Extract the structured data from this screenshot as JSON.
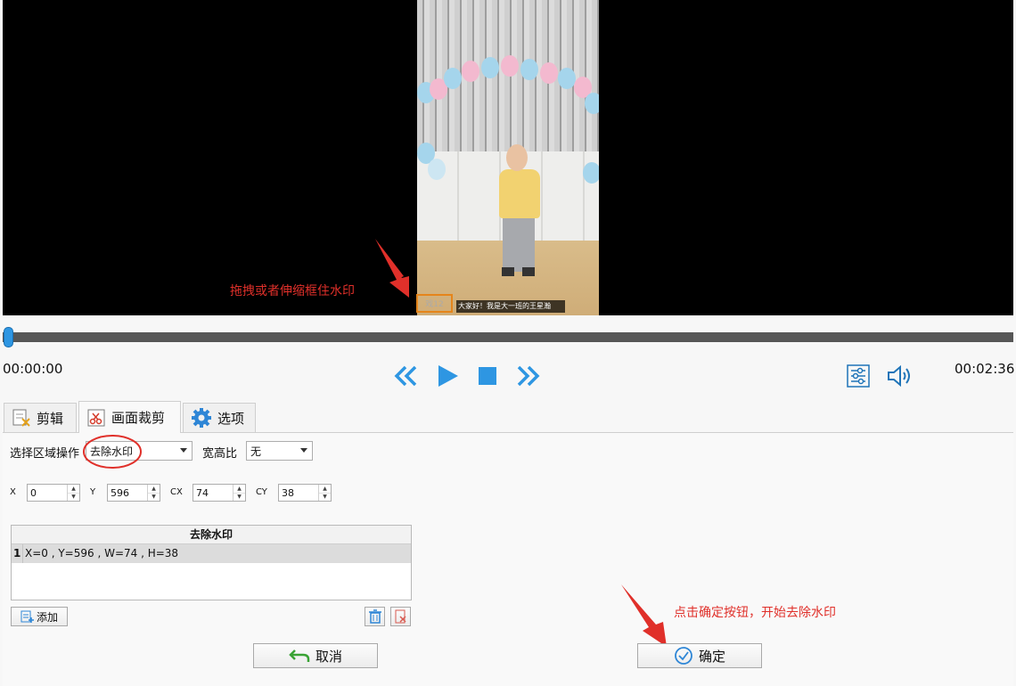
{
  "video": {
    "watermark_text": "戏12",
    "subtitle": "大家好！我是大一班的王星瀚"
  },
  "annotations": {
    "drag_hint": "拖拽或者伸缩框住水印",
    "confirm_hint": "点击确定按钮，开始去除水印",
    "color": "#e0302a"
  },
  "timeline": {
    "current_time": "00:00:00",
    "total_time": "00:02:36",
    "progress": 0
  },
  "tabs": [
    {
      "label": "剪辑",
      "icon": "scissors-doc-icon"
    },
    {
      "label": "画面裁剪",
      "icon": "crop-icon",
      "active": true
    },
    {
      "label": "选项",
      "icon": "gear-icon"
    }
  ],
  "panel": {
    "select_region_label": "选择区域操作",
    "region_op_value": "去除水印",
    "aspect_label": "宽高比",
    "aspect_value": "无",
    "x_label": "X",
    "x_value": "0",
    "y_label": "Y",
    "y_value": "596",
    "cx_label": "CX",
    "cx_value": "74",
    "cy_label": "CY",
    "cy_value": "38",
    "table_header": "去除水印",
    "rows": [
      {
        "index": "1",
        "text": "X=0 , Y=596 , W=74 , H=38"
      }
    ],
    "add_label": "添加",
    "cancel_label": "取消",
    "confirm_label": "确定"
  },
  "colors": {
    "accent": "#2e96e2",
    "watermark_box": "#e5851b"
  }
}
